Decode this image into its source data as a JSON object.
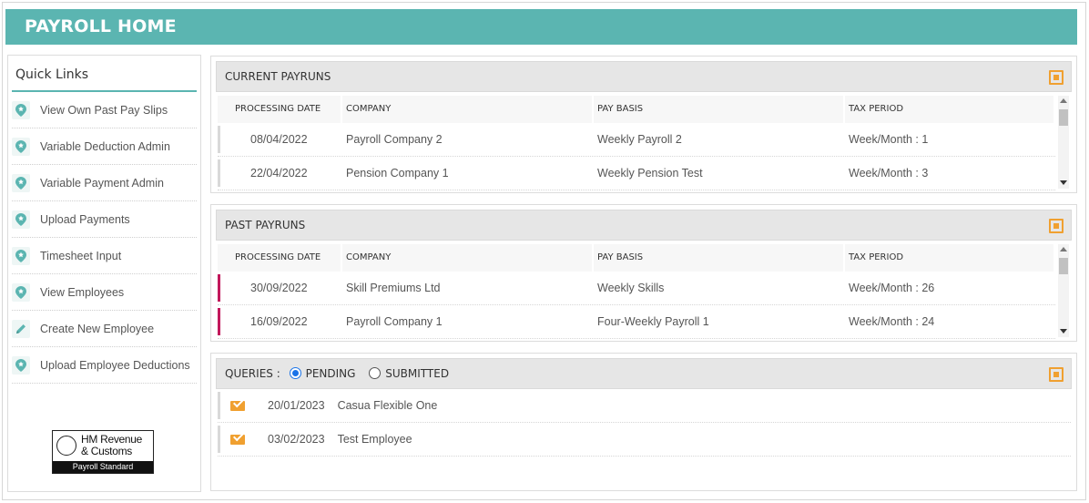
{
  "header": {
    "title": "PAYROLL HOME"
  },
  "colors": {
    "header_bg": "#5bb5b1",
    "accent_orange": "#f0a030",
    "past_marker": "#c2185b",
    "radio_blue": "#1a73e8"
  },
  "sidebar": {
    "title": "Quick Links",
    "items": [
      {
        "label": "View Own Past Pay Slips",
        "icon": "pin-icon"
      },
      {
        "label": "Variable Deduction Admin",
        "icon": "pin-icon"
      },
      {
        "label": "Variable Payment Admin",
        "icon": "pin-icon"
      },
      {
        "label": "Upload Payments",
        "icon": "pin-icon"
      },
      {
        "label": "Timesheet Input",
        "icon": "pin-icon"
      },
      {
        "label": "View Employees",
        "icon": "pin-icon"
      },
      {
        "label": "Create New Employee",
        "icon": "pencil-icon"
      },
      {
        "label": "Upload Employee Deductions",
        "icon": "pin-icon"
      }
    ],
    "logo": {
      "line1": "HM Revenue",
      "line2": "& Customs",
      "bar": "Payroll Standard"
    }
  },
  "current_payruns": {
    "title": "CURRENT PAYRUNS",
    "columns": [
      "PROCESSING DATE",
      "COMPANY",
      "PAY BASIS",
      "TAX PERIOD"
    ],
    "rows": [
      {
        "date": "08/04/2022",
        "company": "Payroll Company 2",
        "basis": "Weekly Payroll 2",
        "period": "Week/Month : 1"
      },
      {
        "date": "22/04/2022",
        "company": "Pension Company 1",
        "basis": "Weekly Pension Test",
        "period": "Week/Month : 3"
      }
    ]
  },
  "past_payruns": {
    "title": "PAST PAYRUNS",
    "columns": [
      "PROCESSING DATE",
      "COMPANY",
      "PAY BASIS",
      "TAX PERIOD"
    ],
    "rows": [
      {
        "date": "30/09/2022",
        "company": "Skill Premiums Ltd",
        "basis": "Weekly Skills",
        "period": "Week/Month : 26"
      },
      {
        "date": "16/09/2022",
        "company": "Payroll Company 1",
        "basis": "Four-Weekly Payroll 1",
        "period": "Week/Month : 24"
      }
    ]
  },
  "queries": {
    "label": "QUERIES :",
    "options": [
      "PENDING",
      "SUBMITTED"
    ],
    "selected": "PENDING",
    "rows": [
      {
        "date": "20/01/2023",
        "name": "Casua Flexible One"
      },
      {
        "date": "03/02/2023",
        "name": "Test Employee"
      }
    ]
  }
}
